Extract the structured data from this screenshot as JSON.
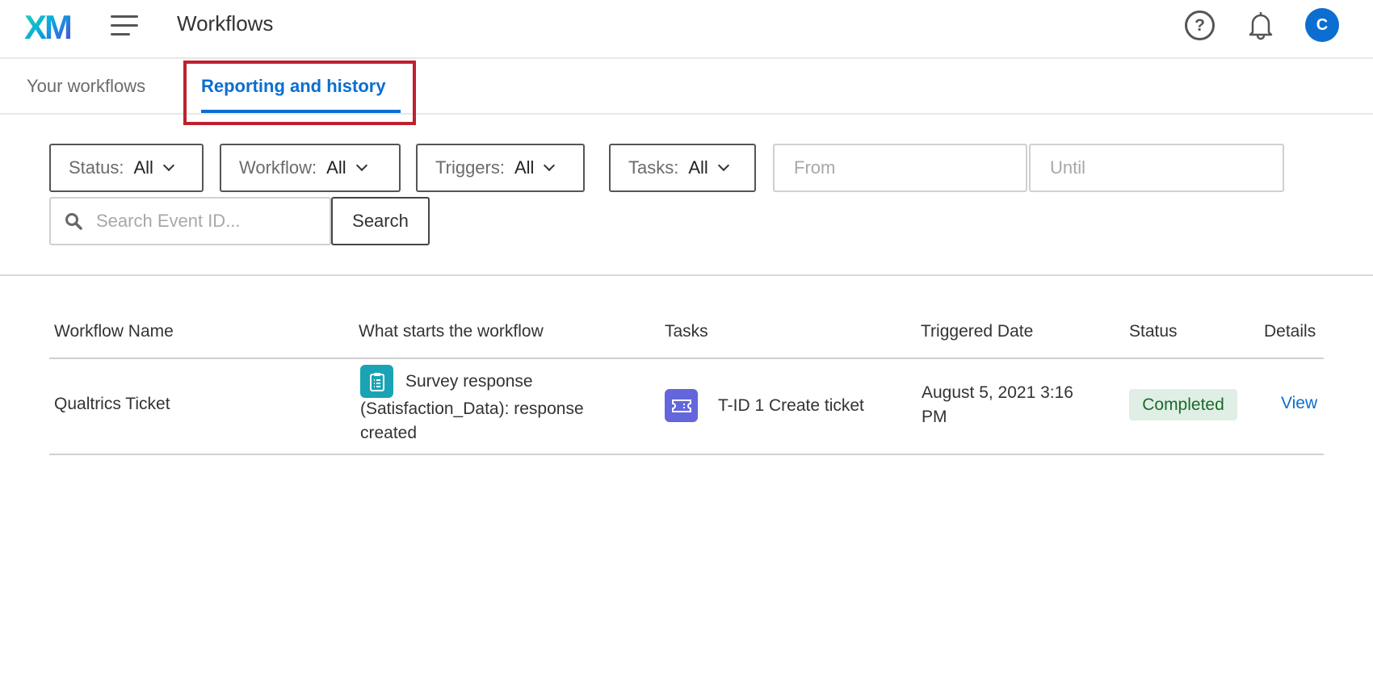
{
  "header": {
    "logo": "XM",
    "title": "Workflows",
    "avatar_initial": "C"
  },
  "tabs": [
    {
      "label": "Your workflows",
      "active": false
    },
    {
      "label": "Reporting and history",
      "active": true
    }
  ],
  "filters": {
    "status": {
      "label": "Status:",
      "value": "All"
    },
    "workflow": {
      "label": "Workflow:",
      "value": "All"
    },
    "triggers": {
      "label": "Triggers:",
      "value": "All"
    },
    "tasks": {
      "label": "Tasks:",
      "value": "All"
    },
    "from_placeholder": "From",
    "until_placeholder": "Until",
    "search_placeholder": "Search Event ID...",
    "search_button": "Search"
  },
  "table": {
    "columns": [
      "Workflow Name",
      "What starts the workflow",
      "Tasks",
      "Triggered Date",
      "Status",
      "Details"
    ],
    "rows": [
      {
        "name": "Qualtrics Ticket",
        "trigger_line1": "Survey response",
        "trigger_line2": "(Satisfaction_Data): response",
        "trigger_line3": "created",
        "task": "T-ID 1 Create ticket",
        "date_line1": "August 5, 2021 3:16",
        "date_line2": "PM",
        "status": "Completed",
        "details": "View"
      }
    ]
  },
  "colors": {
    "accent": "#0b6ed0",
    "highlight": "#c0202e",
    "survey_icon": "#1aa3b5",
    "task_icon": "#6466dc",
    "status_bg": "#e0efe6",
    "status_text": "#1d6a2d"
  }
}
